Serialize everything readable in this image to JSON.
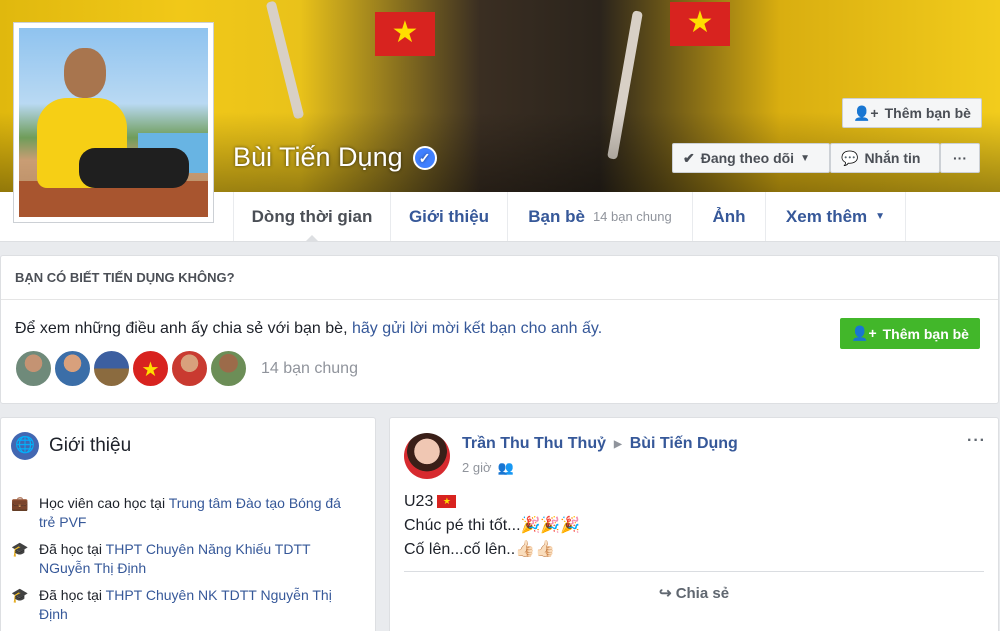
{
  "profile": {
    "name": "Bùi Tiến Dụng",
    "verified_glyph": "✓"
  },
  "header_actions": {
    "add_friend": "Thêm bạn bè",
    "following": "Đang theo dõi",
    "message": "Nhắn tin",
    "more": "···"
  },
  "tabs": [
    {
      "label": "Dòng thời gian"
    },
    {
      "label": "Giới thiệu"
    },
    {
      "label": "Bạn bè",
      "sub": "14 bạn chung"
    },
    {
      "label": "Ảnh"
    },
    {
      "label": "Xem thêm"
    }
  ],
  "know_card": {
    "heading": "BẠN CÓ BIẾT TIẾN DỤNG KHÔNG?",
    "text": "Để xem những điều anh ấy chia sẻ với bạn bè, ",
    "link": "hãy gửi lời mời kết bạn cho anh ấy.",
    "add_button": "Thêm bạn bè",
    "mutual": "14 bạn chung"
  },
  "intro": {
    "title": "Giới thiệu",
    "items": [
      {
        "prefix": "Học viên cao học tại ",
        "link": "Trung tâm Đào tạo Bóng đá trẻ PVF",
        "icon": "briefcase-icon"
      },
      {
        "prefix": "Đã học tại ",
        "link": "THPT Chuyên Năng Khiếu TDTT NGuyễn Thị Định",
        "icon": "graduation-cap-icon"
      },
      {
        "prefix": "Đã học tại ",
        "link": "THPT Chuyên NK TDTT Nguyễn Thị Định",
        "icon": "graduation-cap-icon"
      }
    ]
  },
  "post": {
    "author": "Trần Thu Thu Thuỷ",
    "target": "Bùi Tiến Dụng",
    "time": "2 giờ",
    "line1": "U23",
    "line2": "Chúc pé thi tốt...🎉🎉🎉",
    "line3": "Cố lên...cố lên..👍🏻👍🏻",
    "share": "Chia sẻ",
    "more": "···"
  },
  "colors": {
    "link_blue": "#365899",
    "green": "#42b72a",
    "page_bg": "#e9ebee",
    "flag_red": "#d8231f",
    "flag_star": "#ffde00"
  }
}
